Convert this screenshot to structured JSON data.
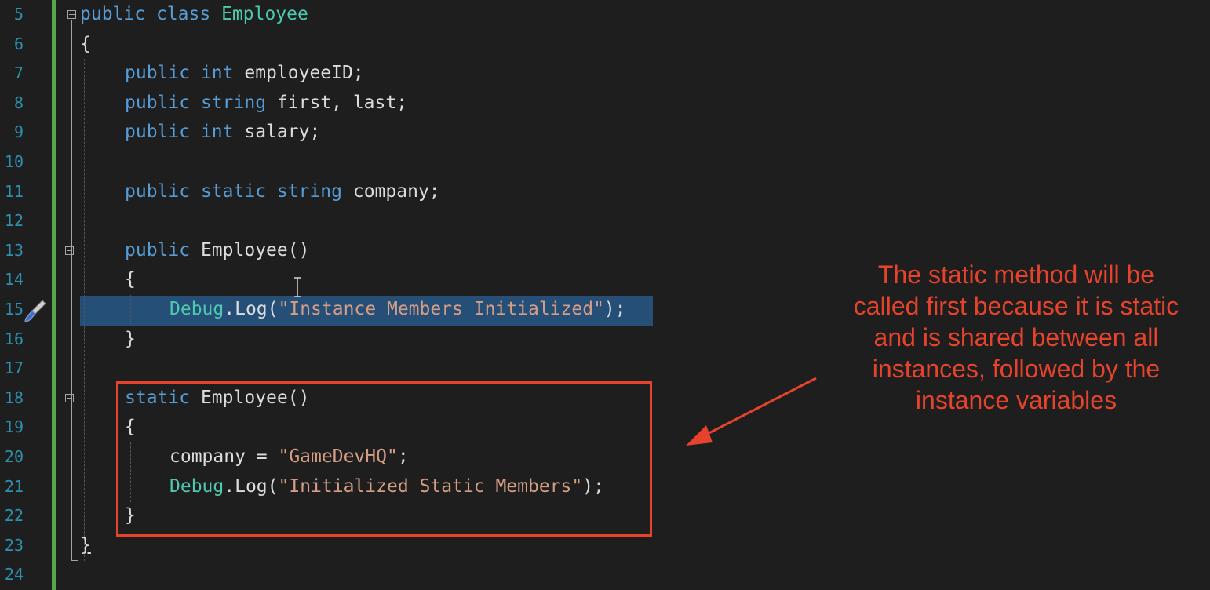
{
  "editor": {
    "line_numbers": [
      "5",
      "6",
      "7",
      "8",
      "9",
      "10",
      "11",
      "12",
      "13",
      "14",
      "15",
      "16",
      "17",
      "18",
      "19",
      "20",
      "21",
      "22",
      "23",
      "24"
    ],
    "code": {
      "line5": {
        "kw1": "public",
        "kw2": "class",
        "name": "Employee"
      },
      "line6": {
        "brace": "{"
      },
      "line7": {
        "kw1": "public",
        "kw2": "int",
        "rest": "employeeID;"
      },
      "line8": {
        "kw1": "public",
        "kw2": "string",
        "rest": "first, last;"
      },
      "line9": {
        "kw1": "public",
        "kw2": "int",
        "rest": "salary;"
      },
      "line11": {
        "kw1": "public",
        "kw2": "static",
        "kw3": "string",
        "rest": "company;"
      },
      "line13": {
        "kw1": "public",
        "rest": "Employee()"
      },
      "line14": {
        "brace": "{"
      },
      "line15": {
        "type": "Debug",
        "rest1": ".Log(",
        "str": "\"Instance Members Initialized\"",
        "rest2": ");"
      },
      "line16": {
        "brace": "}"
      },
      "line18": {
        "kw1": "static",
        "rest": "Employee()"
      },
      "line19": {
        "brace": "{"
      },
      "line20": {
        "rest1": "company = ",
        "str": "\"GameDevHQ\"",
        "rest2": ";"
      },
      "line21": {
        "type": "Debug",
        "rest1": ".Log(",
        "str": "\"Initialized Static Members\"",
        "rest2": ");"
      },
      "line22": {
        "brace": "}"
      },
      "line23": {
        "brace": "}"
      }
    }
  },
  "annotation": {
    "text": "The static method will be called first because it is static and is shared between all instances, followed by the instance variables",
    "color": "#e6432d"
  },
  "colors": {
    "background": "#1e1e1e",
    "keyword": "#569cd6",
    "type": "#4ec9b0",
    "string": "#d69d85",
    "line_number": "#2b91af",
    "change_bar": "#57a64a",
    "selection": "#264f78"
  },
  "icons": {
    "breakpoint": "paintbrush-icon",
    "cursor": "text-cursor-icon"
  }
}
